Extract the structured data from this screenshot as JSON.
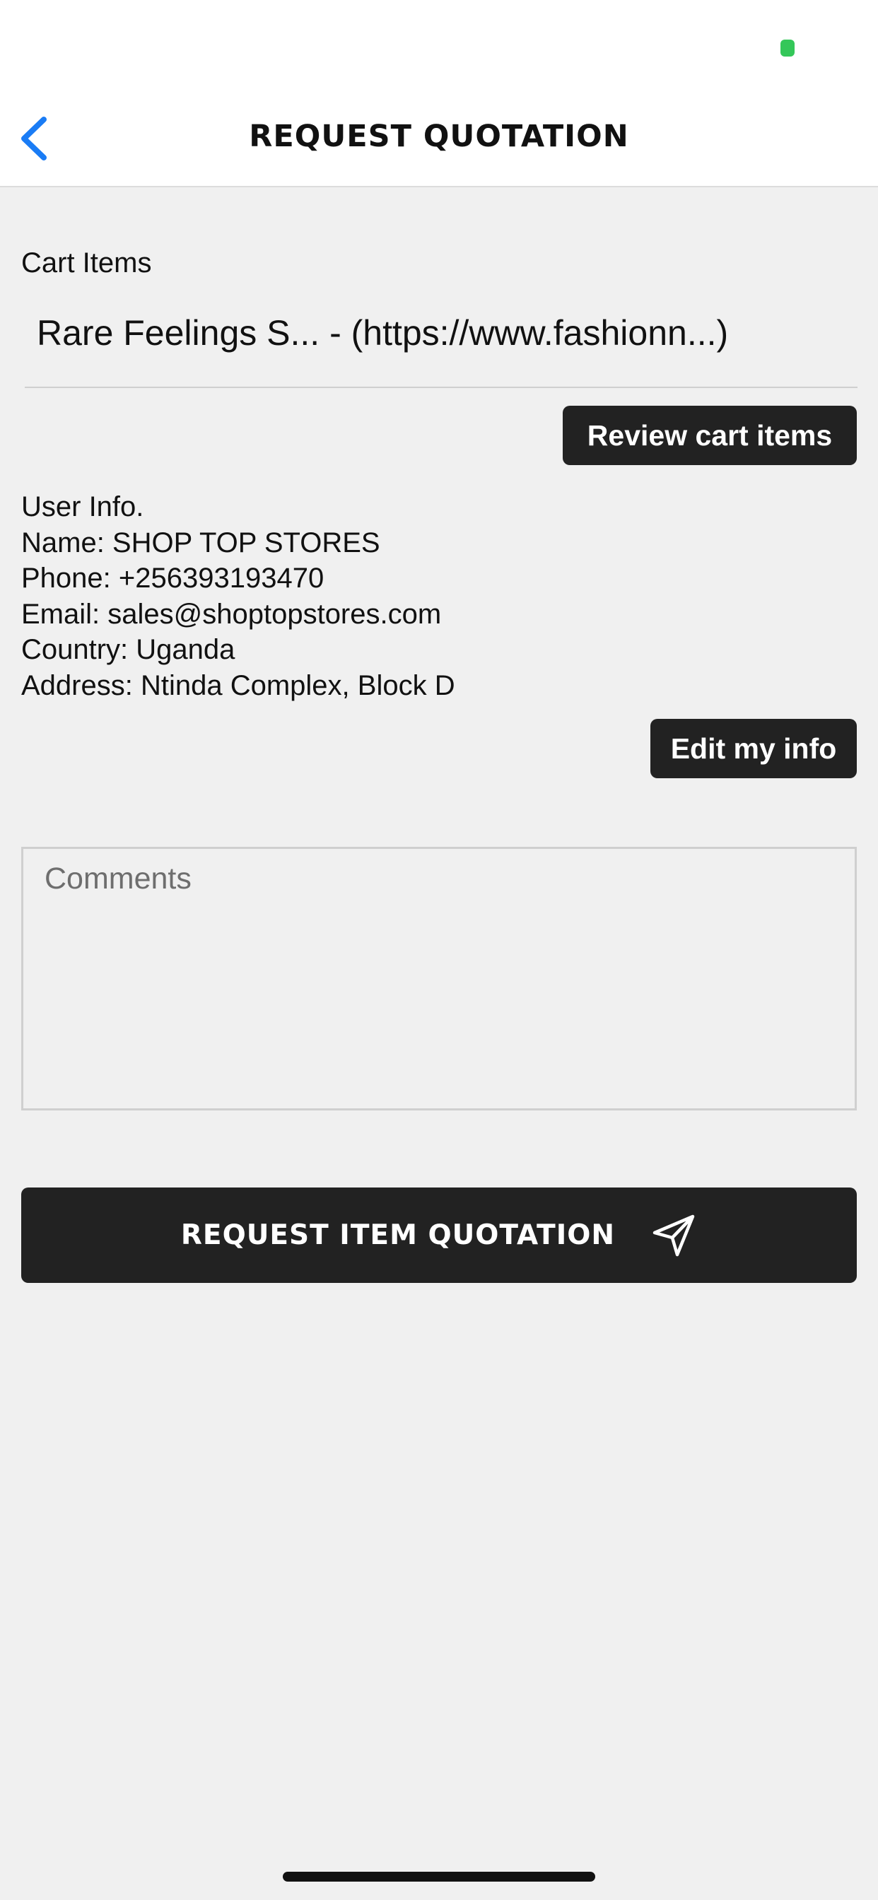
{
  "status_bar": {
    "indicator_color": "#34c759"
  },
  "header": {
    "back_icon": "chevron-left-icon",
    "title": "REQUEST QUOTATION",
    "accent_color": "#1a7cf5"
  },
  "cart": {
    "label": "Cart Items",
    "item": "Rare Feelings S... - (https://www.fashionn...)",
    "review_button": "Review cart items"
  },
  "user_info": {
    "heading": "User Info.",
    "name": "Name: SHOP TOP STORES",
    "phone": "Phone: +256393193470",
    "email": "Email: sales@shoptopstores.com",
    "country": "Country: Uganda",
    "address": "Address: Ntinda Complex, Block D",
    "edit_button": "Edit my info"
  },
  "comments": {
    "placeholder": "Comments",
    "value": ""
  },
  "submit": {
    "label": "REQUEST ITEM QUOTATION",
    "icon": "send-icon"
  }
}
